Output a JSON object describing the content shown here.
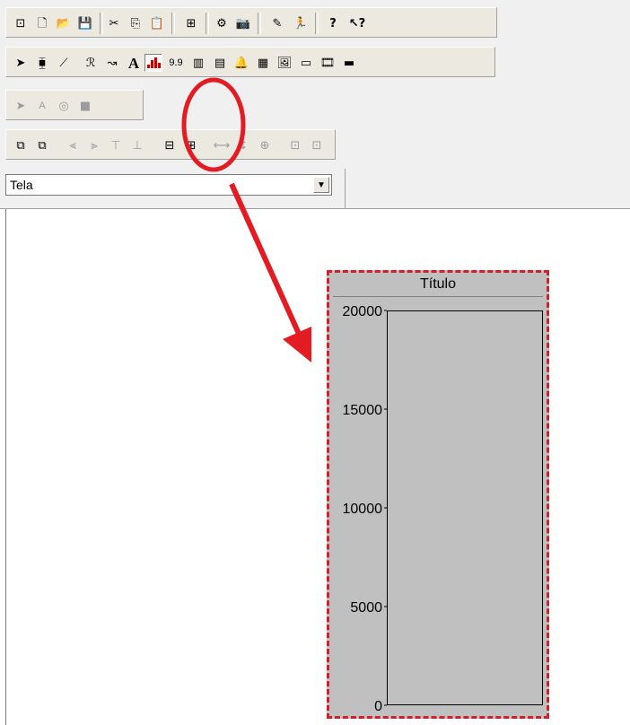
{
  "colors": {
    "annotation_red": "#e31b23",
    "chart_border": "#d21f2a",
    "chart_background": "#c0c0c0",
    "toolbar_background": "#ece9e0"
  },
  "toolbar_rows": [
    {
      "buttons": [
        {
          "icon": "new-project-icon",
          "glyph": "⊡"
        },
        {
          "icon": "new-document-icon",
          "glyph": "🗋"
        },
        {
          "icon": "open-folder-icon",
          "glyph": "📂"
        },
        {
          "icon": "save-icon",
          "glyph": "💾"
        },
        {
          "icon": "cut-icon",
          "glyph": "✂"
        },
        {
          "icon": "copy-icon",
          "glyph": "⎘"
        },
        {
          "icon": "paste-icon",
          "glyph": "📋"
        },
        {
          "icon": "tree-view-icon",
          "glyph": "⊞"
        },
        {
          "icon": "properties-icon",
          "glyph": "⚙"
        },
        {
          "icon": "camera-icon",
          "glyph": "📷"
        },
        {
          "icon": "edit-screen-icon",
          "glyph": "✎"
        },
        {
          "icon": "run-icon",
          "glyph": "🏃"
        },
        {
          "icon": "help-icon",
          "glyph": "?"
        },
        {
          "icon": "context-help-icon",
          "glyph": "↖?"
        }
      ]
    },
    {
      "buttons": [
        {
          "icon": "selection-arrow-icon",
          "glyph": "➤"
        },
        {
          "icon": "component-icon",
          "glyph": "⧯"
        },
        {
          "icon": "line-icon",
          "glyph": "⟋"
        },
        {
          "icon": "polygon-icon",
          "glyph": "ℛ"
        },
        {
          "icon": "curve-icon",
          "glyph": "↝"
        },
        {
          "icon": "text-icon",
          "glyph": "A"
        },
        {
          "icon": "trend-chart-icon",
          "glyph": ""
        },
        {
          "icon": "display-value-icon",
          "glyph": "9.9"
        },
        {
          "icon": "slider-icon",
          "glyph": "▥"
        },
        {
          "icon": "bar-graph-icon",
          "glyph": "▤"
        },
        {
          "icon": "alarm-icon",
          "glyph": "🔔"
        },
        {
          "icon": "calendar-icon",
          "glyph": "▦"
        },
        {
          "icon": "picture-icon",
          "glyph": "🖼"
        },
        {
          "icon": "button-control-icon",
          "glyph": "▭"
        },
        {
          "icon": "film-icon",
          "glyph": "🎞"
        },
        {
          "icon": "device-icon",
          "glyph": "▬"
        }
      ]
    },
    {
      "buttons": [
        {
          "icon": "pointer-disabled-icon",
          "glyph": "➤"
        },
        {
          "icon": "font-disabled-icon",
          "glyph": "A"
        },
        {
          "icon": "color-wheel-disabled-icon",
          "glyph": "◎"
        },
        {
          "icon": "fill-disabled-icon",
          "glyph": "■"
        }
      ]
    },
    {
      "buttons": [
        {
          "icon": "bring-to-front-icon",
          "glyph": "⧉"
        },
        {
          "icon": "send-to-back-icon",
          "glyph": "⧉"
        },
        {
          "icon": "align-left-icon",
          "glyph": "⫷"
        },
        {
          "icon": "align-right-icon",
          "glyph": "⫸"
        },
        {
          "icon": "align-top-icon",
          "glyph": "⊤"
        },
        {
          "icon": "align-bottom-icon",
          "glyph": "⊥"
        },
        {
          "icon": "center-vertical-icon",
          "glyph": "⊟"
        },
        {
          "icon": "center-horizontal-icon",
          "glyph": "⊞"
        },
        {
          "icon": "same-width-icon",
          "glyph": "⟷"
        },
        {
          "icon": "same-height-icon",
          "glyph": "↕"
        },
        {
          "icon": "same-size-icon",
          "glyph": "⊕"
        },
        {
          "icon": "group-icon",
          "glyph": "⊡"
        },
        {
          "icon": "ungroup-icon",
          "glyph": "⊡"
        }
      ]
    }
  ],
  "screen_selector": {
    "value": "Tela"
  },
  "chart": {
    "title": "Título"
  },
  "chart_data": {
    "type": "bar",
    "title": "Título",
    "xlabel": "",
    "ylabel": "",
    "ylim": [
      0,
      20000
    ],
    "y_ticks": [
      "0",
      "5000",
      "10000",
      "15000",
      "20000"
    ],
    "categories": [],
    "values": []
  }
}
